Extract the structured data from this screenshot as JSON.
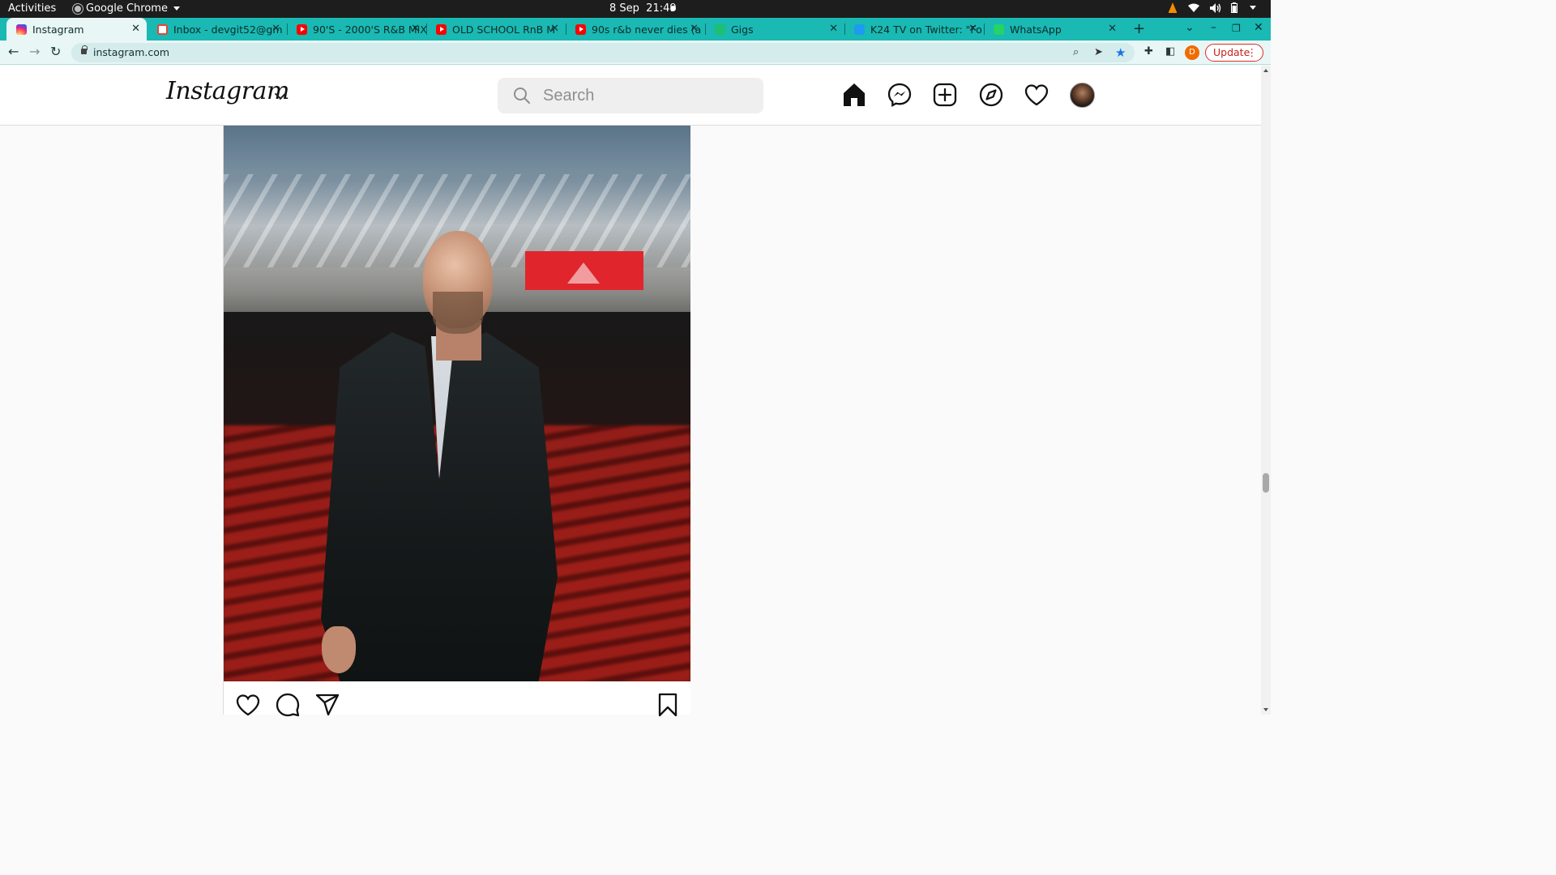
{
  "system_bar": {
    "activities": "Activities",
    "app_name": "Google Chrome",
    "date": "8 Sep",
    "time": "21:49",
    "tray_icons": [
      "vlc-icon",
      "wifi-icon",
      "volume-icon",
      "battery-icon",
      "power-menu-icon"
    ]
  },
  "tabs": [
    {
      "title": "Instagram",
      "favicon": "instagram-icon",
      "active": true
    },
    {
      "title": "Inbox - devgit52@gm",
      "favicon": "gmail-icon",
      "active": false
    },
    {
      "title": "90'S - 2000'S R&B MIX",
      "favicon": "youtube-icon",
      "active": false
    },
    {
      "title": "OLD SCHOOL RnB M",
      "favicon": "youtube-icon",
      "active": false
    },
    {
      "title": "90s r&b never dies (a",
      "favicon": "youtube-icon",
      "active": false
    },
    {
      "title": "Gigs",
      "favicon": "fiverr-icon",
      "active": false
    },
    {
      "title": "K24 TV on Twitter: \"Fo",
      "favicon": "twitter-icon",
      "active": false
    },
    {
      "title": "WhatsApp",
      "favicon": "whatsapp-icon",
      "active": false
    }
  ],
  "address_bar": {
    "url": "instagram.com",
    "profile_initial": "D",
    "update_label": "Update"
  },
  "instagram": {
    "logo": "Instagram",
    "search_placeholder": "Search",
    "nav_icons": [
      "home-icon",
      "messenger-icon",
      "new-post-icon",
      "explore-icon",
      "activity-heart-icon",
      "profile-avatar"
    ]
  },
  "post": {
    "image_description_icon": "photo",
    "actions": [
      "like-icon",
      "comment-icon",
      "share-icon",
      "save-icon"
    ]
  },
  "colors": {
    "tab_strip": "#1ab9b3",
    "active_tab": "#e9f6f6",
    "update_red": "#d93025"
  }
}
